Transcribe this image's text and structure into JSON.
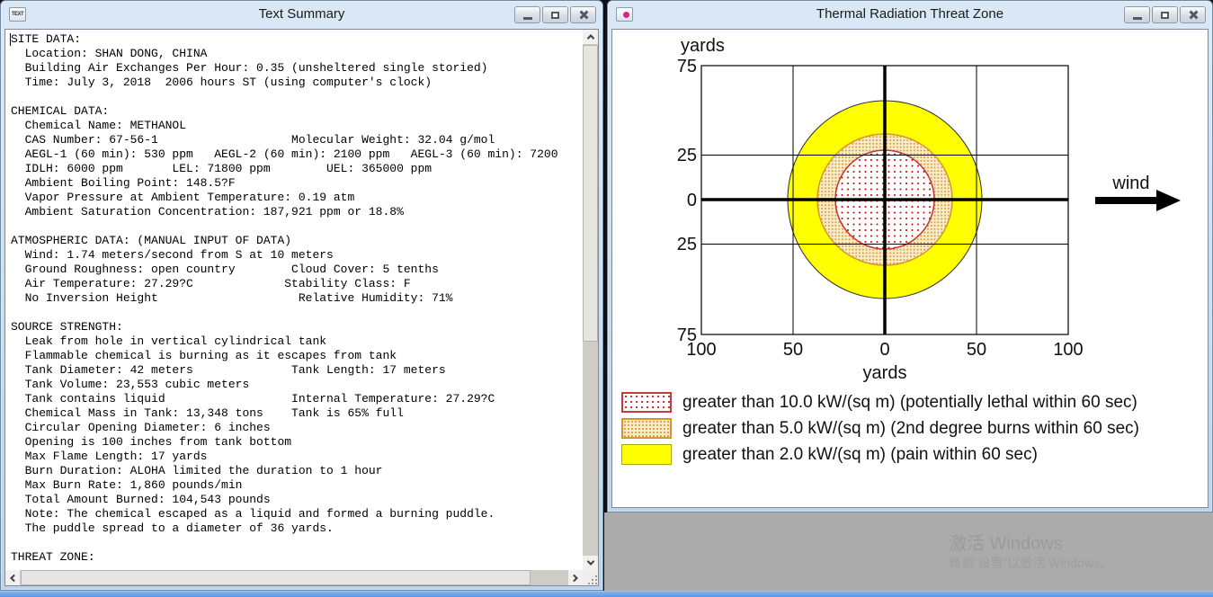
{
  "left_window": {
    "title": "Text Summary",
    "icon_text": "TEXT",
    "lines": [
      "SITE DATA:",
      "  Location: SHAN DONG, CHINA",
      "  Building Air Exchanges Per Hour: 0.35 (unsheltered single storied)",
      "  Time: July 3, 2018  2006 hours ST (using computer's clock)",
      "",
      "CHEMICAL DATA:",
      "  Chemical Name: METHANOL",
      "  CAS Number: 67-56-1                   Molecular Weight: 32.04 g/mol",
      "  AEGL-1 (60 min): 530 ppm   AEGL-2 (60 min): 2100 ppm   AEGL-3 (60 min): 7200",
      "  IDLH: 6000 ppm       LEL: 71800 ppm        UEL: 365000 ppm",
      "  Ambient Boiling Point: 148.5?F",
      "  Vapor Pressure at Ambient Temperature: 0.19 atm",
      "  Ambient Saturation Concentration: 187,921 ppm or 18.8%",
      "",
      "ATMOSPHERIC DATA: (MANUAL INPUT OF DATA)",
      "  Wind: 1.74 meters/second from S at 10 meters",
      "  Ground Roughness: open country        Cloud Cover: 5 tenths",
      "  Air Temperature: 27.29?C             Stability Class: F",
      "  No Inversion Height                    Relative Humidity: 71%",
      "",
      "SOURCE STRENGTH:",
      "  Leak from hole in vertical cylindrical tank",
      "  Flammable chemical is burning as it escapes from tank",
      "  Tank Diameter: 42 meters              Tank Length: 17 meters",
      "  Tank Volume: 23,553 cubic meters",
      "  Tank contains liquid                  Internal Temperature: 27.29?C",
      "  Chemical Mass in Tank: 13,348 tons    Tank is 65% full",
      "  Circular Opening Diameter: 6 inches",
      "  Opening is 100 inches from tank bottom",
      "  Max Flame Length: 17 yards",
      "  Burn Duration: ALOHA limited the duration to 1 hour",
      "  Max Burn Rate: 1,860 pounds/min",
      "  Total Amount Burned: 104,543 pounds",
      "  Note: The chemical escaped as a liquid and formed a burning puddle.",
      "  The puddle spread to a diameter of 36 yards.",
      "",
      "THREAT ZONE:"
    ]
  },
  "right_window": {
    "title": "Thermal Radiation Threat Zone",
    "chart": {
      "unit_top": "yards",
      "unit_bottom": "yards",
      "y_ticks": [
        "75",
        "25",
        "0",
        "25",
        "75"
      ],
      "x_ticks": [
        "100",
        "50",
        "0",
        "50",
        "100"
      ],
      "wind_label": "wind",
      "legend": [
        {
          "swatch": "red-dotted",
          "label": "greater than 10.0 kW/(sq m) (potentially lethal within 60 sec)"
        },
        {
          "swatch": "orange-stippled",
          "label": "greater than 5.0 kW/(sq m) (2nd degree burns within 60 sec)"
        },
        {
          "swatch": "yellow-solid",
          "label": "greater than 2.0 kW/(sq m) (pain within 60 sec)"
        }
      ]
    }
  },
  "chart_data": {
    "type": "area",
    "title": "Thermal Radiation Threat Zone",
    "xlabel": "yards",
    "ylabel": "yards",
    "xlim": [
      -100,
      100
    ],
    "ylim": [
      -75,
      75
    ],
    "grid": "on",
    "grid_spacing_yards": 50,
    "center": [
      0,
      0
    ],
    "wind_direction": "left-to-right",
    "zones": [
      {
        "name": "red",
        "threshold_kw_per_sqm": 10.0,
        "effect": "potentially lethal within 60 sec",
        "radius_yards": 27,
        "fill": "red dots on white"
      },
      {
        "name": "orange",
        "threshold_kw_per_sqm": 5.0,
        "effect": "2nd degree burns within 60 sec",
        "radius_yards": 36,
        "fill": "orange stipple on tan"
      },
      {
        "name": "yellow",
        "threshold_kw_per_sqm": 2.0,
        "effect": "pain within 60 sec",
        "radius_yards": 54,
        "fill": "solid yellow"
      }
    ],
    "legend_position": "below plot"
  },
  "desktop": {
    "watermark_title": "激活 Windows",
    "watermark_subtitle": "转到“设置”以激活 Windows。"
  },
  "colors": {
    "zone_red_dot": "#c40000",
    "zone_orange_dot": "#dd9226",
    "zone_orange_bg": "#f6ecc9",
    "zone_yellow": "#ffff00",
    "titlebar": "#cfe0f2",
    "taskbar": "#6aa3e9",
    "desktop": "#ababab"
  }
}
